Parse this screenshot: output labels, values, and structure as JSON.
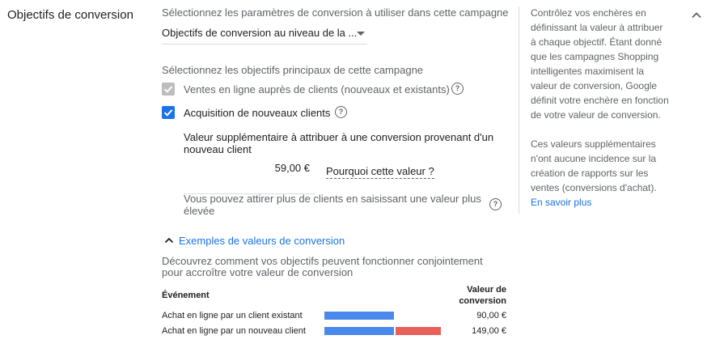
{
  "section": {
    "title": "Objectifs de conversion"
  },
  "settings": {
    "params_label": "Sélectionnez les paramètres de conversion à utiliser dans cette campagne",
    "dropdown_value": "Objectifs de conversion au niveau de la ...",
    "goals_label": "Sélectionnez les objectifs principaux de cette campagne",
    "goal1": {
      "label": "Ventes en ligne auprès de clients (nouveaux et existants)",
      "checked": true,
      "disabled": true
    },
    "goal2": {
      "label": "Acquisition de nouveaux clients",
      "checked": true,
      "disabled": false
    },
    "extra_value_label_line1": "Valeur supplémentaire à attribuer à une conversion provenant d'un",
    "extra_value_label_line2": "nouveau client",
    "extra_value": "59,00 €",
    "why_value_link": "Pourquoi cette valeur ?",
    "hint_line1": "Vous pouvez attirer plus de clients en saisissant une valeur plus",
    "hint_line2": "élevée"
  },
  "examples": {
    "toggle_label": "Exemples de valeurs de conversion",
    "desc_line1": "Découvrez comment vos objectifs peuvent fonctionner conjointement",
    "desc_line2": "pour accroître votre valeur de conversion",
    "col_event": "Événement",
    "col_value_line1": "Valeur de",
    "col_value_line2": "conversion",
    "rows": [
      {
        "event": "Achat en ligne par un client existant",
        "value": "90,00 €",
        "base": 90,
        "extra": 0
      },
      {
        "event": "Achat en ligne par un nouveau client",
        "value": "149,00 €",
        "base": 90,
        "extra": 59
      }
    ],
    "colors": {
      "base": "#4a89ec",
      "extra": "#e8605a"
    }
  },
  "sidebar": {
    "para1_lines": [
      "Contrôlez vos enchères en",
      "définissant la valeur à attribuer",
      "à chaque objectif. Étant donné",
      "que les campagnes Shopping",
      "intelligentes maximisent la",
      "valeur de conversion, Google",
      "définit votre enchère en fonction",
      "de votre valeur de conversion."
    ],
    "para2_lines": [
      "Ces valeurs supplémentaires",
      "n'ont aucune incidence sur la",
      "création de rapports sur les",
      "ventes (conversions d'achat)."
    ],
    "learn_more": "En savoir plus"
  },
  "colors": {
    "accent": "#1a73e8",
    "checkbox_disabled": "#bdbdbd"
  },
  "icons": {
    "collapse": "chevron-up-icon",
    "help": "help-circle-icon",
    "dropdown": "caret-down-icon"
  }
}
